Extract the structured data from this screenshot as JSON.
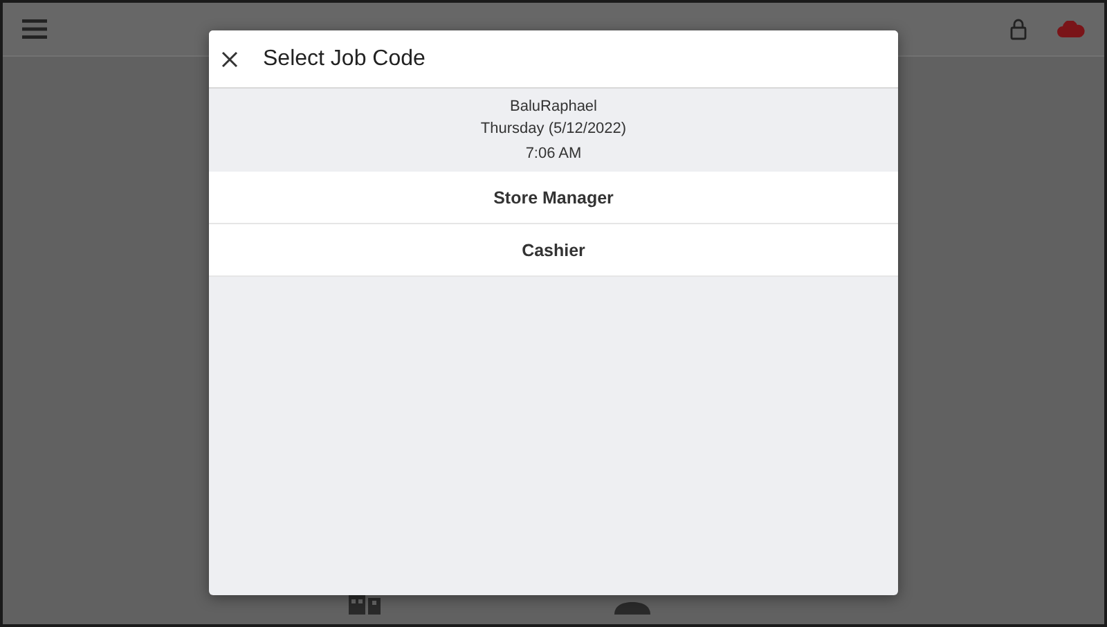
{
  "dialog": {
    "title": "Select Job Code",
    "employee": "BaluRaphael",
    "date": "Thursday (5/12/2022)",
    "time": "7:06 AM",
    "job_codes": [
      {
        "label": "Store Manager"
      },
      {
        "label": "Cashier"
      }
    ]
  }
}
